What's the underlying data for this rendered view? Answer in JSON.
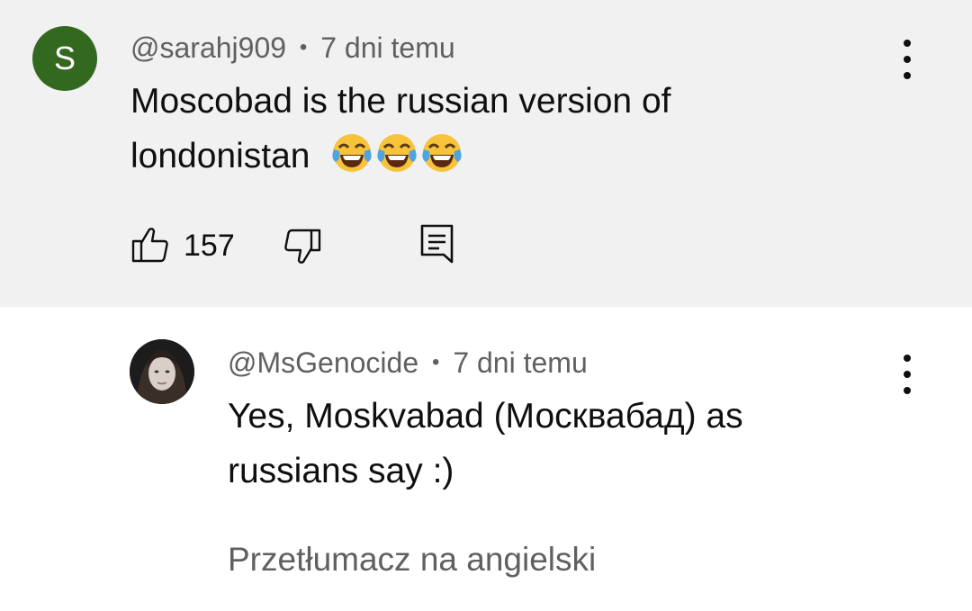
{
  "comment": {
    "avatar_letter": "S",
    "avatar_color": "#33691e",
    "author": "@sarahj909",
    "separator": "•",
    "time": "7 dni temu",
    "text_line1": "Moscobad is the russian version of",
    "text_line2": "londonistan",
    "emojis": [
      "face-with-tears-of-joy",
      "face-with-tears-of-joy",
      "face-with-tears-of-joy"
    ],
    "like_count": "157",
    "icons": [
      "thumbs-up-icon",
      "thumbs-down-icon",
      "reply-comment-icon",
      "more-vert-icon"
    ]
  },
  "reply": {
    "author": "@MsGenocide",
    "separator": "•",
    "time": "7 dni temu",
    "text_line1": "Yes, Moskvabad (Москвабад) as",
    "text_line2": "russians say :)",
    "translate_label": "Przetłumacz na angielski",
    "icons": [
      "more-vert-icon"
    ]
  },
  "colors": {
    "highlight_bg": "#f1f1f1",
    "secondary_text": "#606060",
    "primary_text": "#0f0f0f"
  }
}
